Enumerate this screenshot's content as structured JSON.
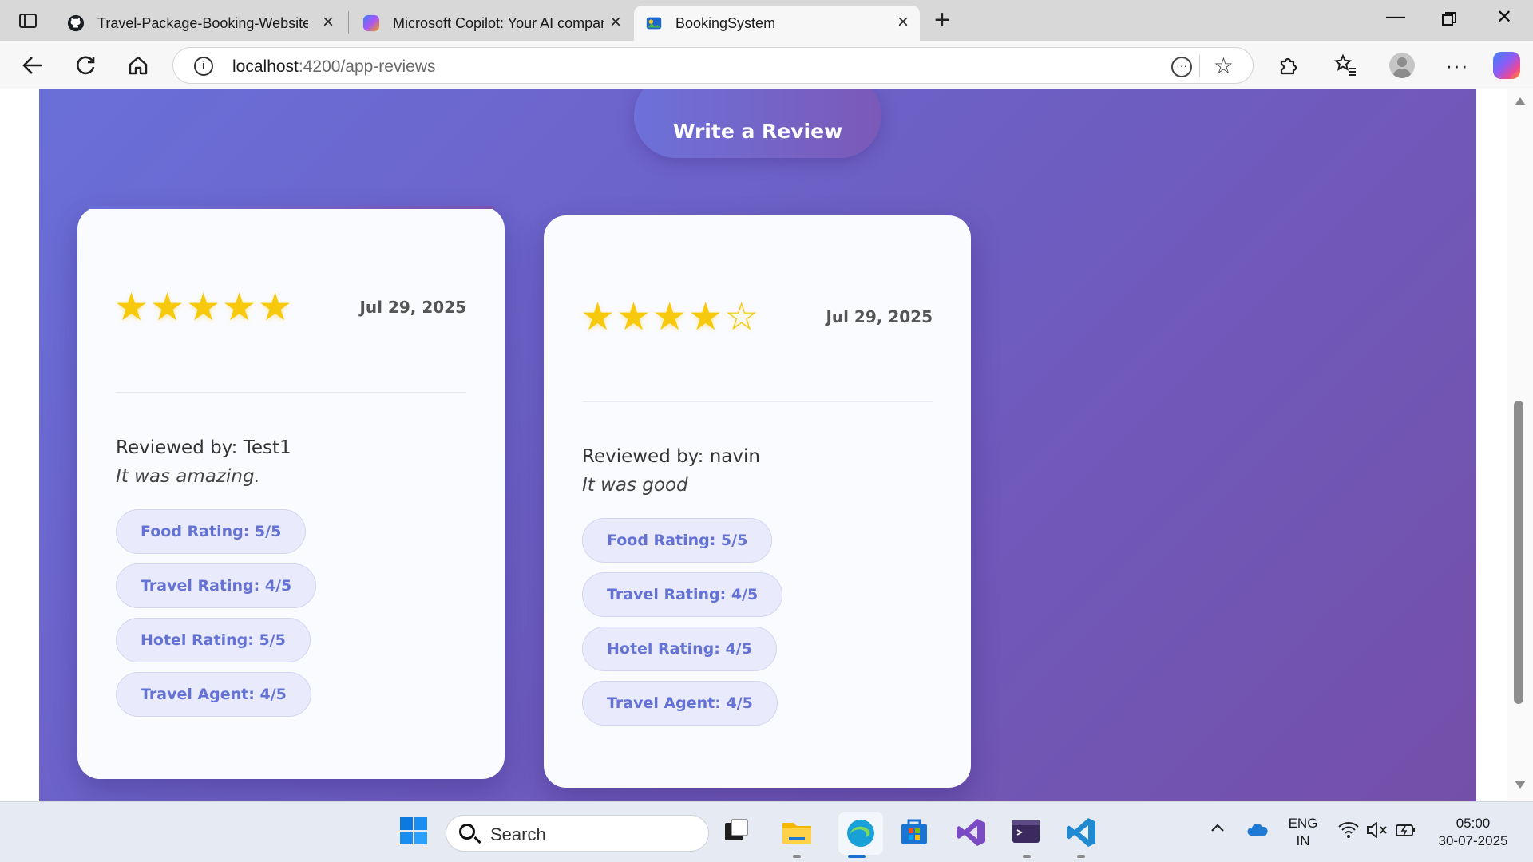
{
  "browser": {
    "tabs": [
      {
        "title": "Travel-Package-Booking-Website",
        "icon": "github-icon"
      },
      {
        "title": "Microsoft Copilot: Your AI compan",
        "icon": "copilot-icon"
      },
      {
        "title": "BookingSystem",
        "icon": "booking-favicon",
        "active": true
      }
    ],
    "url_host": "localhost",
    "url_rest": ":4200/app-reviews"
  },
  "page": {
    "write_review_label": "Write a Review",
    "reviews": [
      {
        "stars": 5,
        "date": "Jul 29, 2025",
        "reviewer": "Reviewed by: Test1",
        "comment": "It was amazing.",
        "ratings": [
          "Food Rating: 5/5",
          "Travel Rating: 4/5",
          "Hotel Rating: 5/5",
          "Travel Agent: 4/5"
        ]
      },
      {
        "stars": 4,
        "date": "Jul 29, 2025",
        "reviewer": "Reviewed by: navin",
        "comment": "It was good",
        "ratings": [
          "Food Rating: 5/5",
          "Travel Rating: 4/5",
          "Hotel Rating: 4/5",
          "Travel Agent: 4/5"
        ]
      }
    ]
  },
  "taskbar": {
    "search_label": "Search",
    "lang_line1": "ENG",
    "lang_line2": "IN",
    "time": "05:00",
    "date": "30-07-2025"
  },
  "colors": {
    "accent_purple": "#6d5fc4",
    "star_gold": "#f7c90c",
    "pill_text": "#6472d4"
  }
}
